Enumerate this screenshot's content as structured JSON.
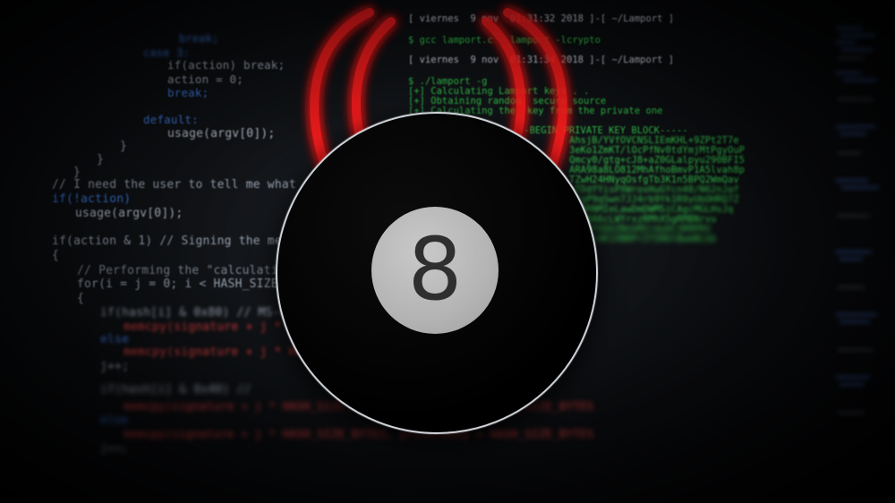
{
  "code_lines": {
    "l1": "break;",
    "l2": "case 3:",
    "l3": "if(action) break;",
    "l4": "action = 0;",
    "l5": "break;",
    "l6": "default:",
    "l7": "usage(argv[0]);",
    "l8": "}",
    "l9": "}",
    "l10": "}",
    "l11": "// I need the user to tell me what the f",
    "l12": "if(!action)",
    "l13": "usage(argv[0]);",
    "l14": "if(action & 1) // Signing the message",
    "l15": "{",
    "l16": "// Performing the \"calculation\" o",
    "l17": "for(i = j = 0; i < HASH_SIZE_BYTES",
    "l18": "{",
    "l19": "if(hash[i] & 0x80) // MS-bit o",
    "l20": "memcpy(signature + j * HASH_",
    "l21": "else",
    "l22": "memcpy(signature + j * HASH_S",
    "l23": "j++;",
    "l24": "if(hash[i] & 0x40) //",
    "l25": "memcpy(signature + j * HASH_SIZE_BYTES, privateKey + HASH_SIZE_BYTES",
    "l26": "else",
    "l27": "memcpy(signature + j * HASH_SIZE_BYTES, privateKey + HASH_SIZE_BYTES",
    "l28": "j++;"
  },
  "terminal_lines": {
    "t1": "[ viernes  9 nov  01:31:32 2018 ]-[ ~/Lamport ]",
    "t2": "$ gcc lamport.c   lamport -lcrypto",
    "t3": "[ viernes  9 nov  01:31:34 2018 ]-[ ~/Lamport ]",
    "t4": "$ ./lamport -g",
    "t5": "[+] Calculating Lamport keys . .",
    "t6": "[+] Obtaining random  secure source",
    "t7": "[+] Calculating the  key from the private one",
    "t8": "-----BEGIN PRIVATE KEY BLOCK-----",
    "t9": "AhsjB/YVfOVCNSLIEmKHL+9ZPt2T7e",
    "t10": "3eKo1ZmKT/lOcPfNv0tdYmjMtPgyOuP",
    "t11": "Qmcy0/gtg+cJ8+aZ0GLalpyu290BFI5",
    "t12": "ARA98a8LO812MhAfhoBmvP1A5lvah8p",
    "t13": "TZwH24HNyqOsfgTb3K1n5BPQ2WmQav",
    "t14": "qTDdfYisPXWrosHuGYcn48/N62nJaf",
    "t15": "LEqP9qSwn7JJ4rb9Yk1R9yUbOHRQ7Z",
    "t16": "lVBRNMIeLawDmDWMSiCAgcMGLHsJq",
    "t17": "OQLBA6cLWYrxzRMhXSgRMBNrvu",
    "t18": "n6MPfVQXZNnhMIrdyDC3RMPRV",
    "t19": "Z1LFi4K1XNRPr2TSHUlBwmBLGb"
  },
  "ball": {
    "number": "8"
  },
  "colors": {
    "background": "#0b0d10",
    "neon_red": "#ff1e1e",
    "terminal_green": "#32c24a",
    "ball_face": "#b4b4b4",
    "ball_number": "#2f2f2f"
  },
  "icons": {
    "logo": "hack-8ball-icon"
  }
}
